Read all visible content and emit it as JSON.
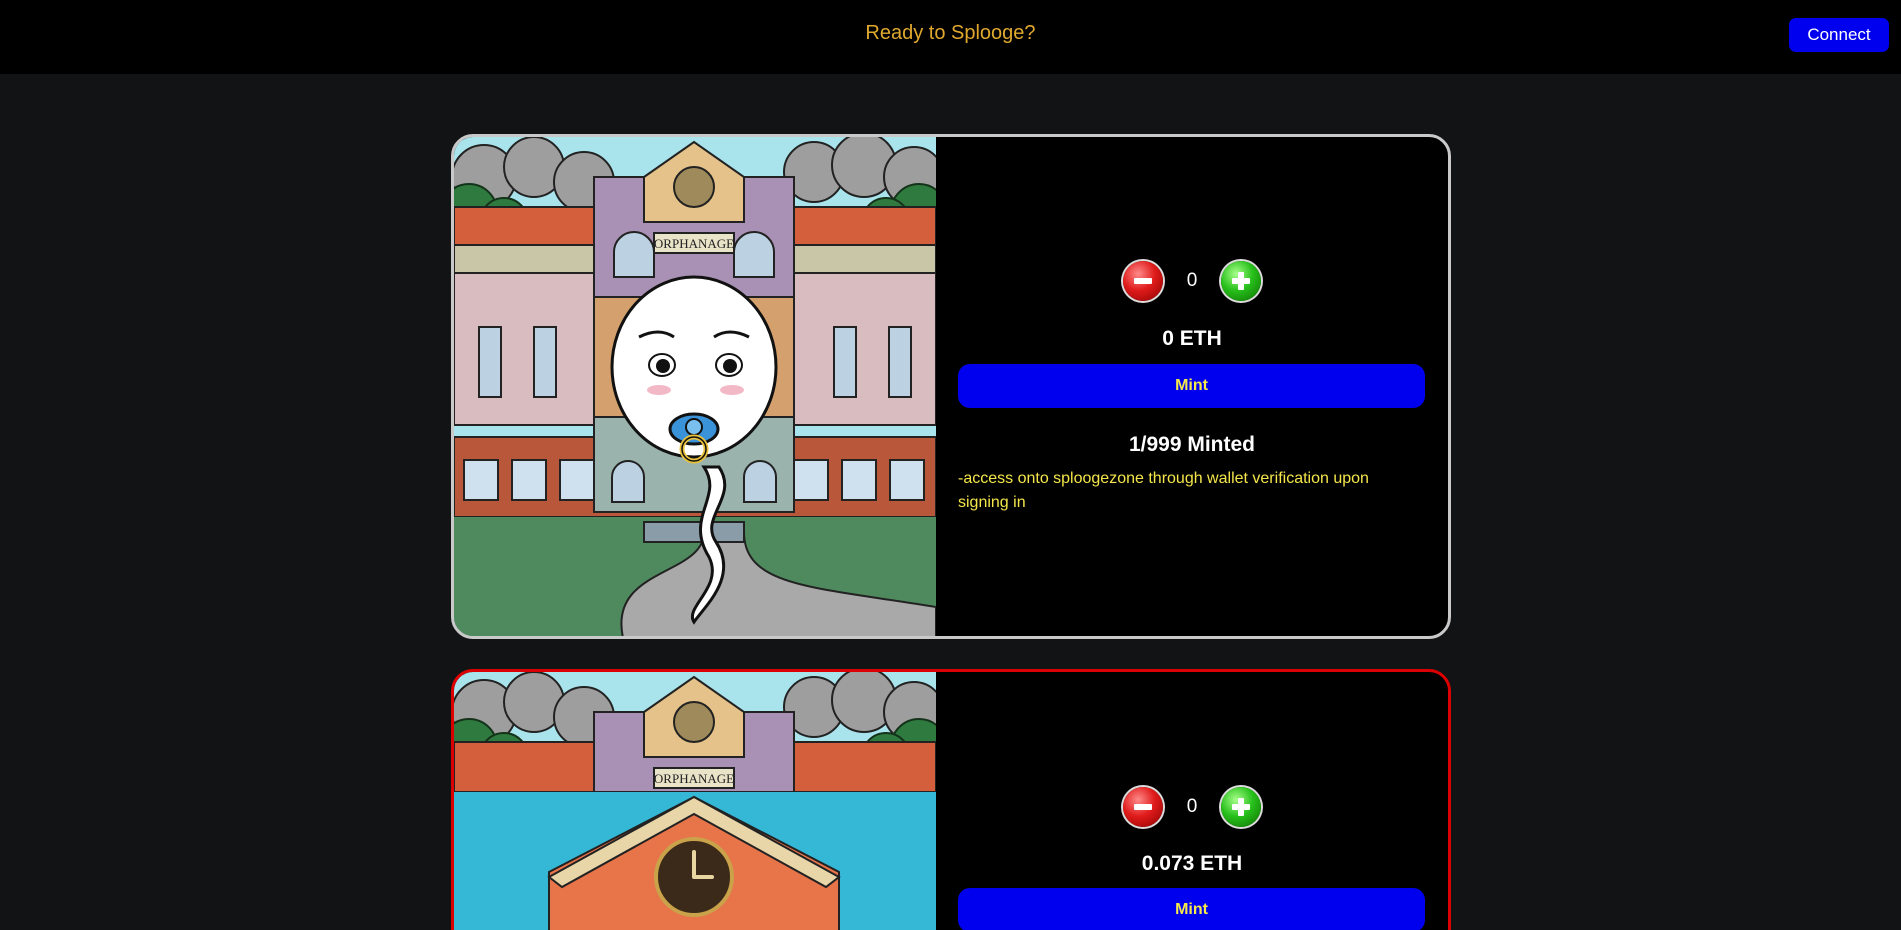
{
  "header": {
    "title": "Ready to Splooge?",
    "connect_label": "Connect"
  },
  "cards": [
    {
      "sign_text": "ORPHANAGE",
      "quantity": "0",
      "price": "0 ETH",
      "mint_label": "Mint",
      "minted": "1/999 Minted",
      "description": "-access onto sploogezone through wallet verification upon signing in",
      "border_color": "#c9c9c9"
    },
    {
      "sign_text": "ORPHANAGE",
      "quantity": "0",
      "price": "0.073 ETH",
      "mint_label": "Mint",
      "border_color": "#dd0000"
    }
  ],
  "colors": {
    "accent_blue": "#0000ee",
    "title_gold": "#e0a92e",
    "desc_yellow": "#f4e64a",
    "background": "#121315"
  },
  "icons": [
    "minus-circle-icon",
    "plus-circle-icon"
  ]
}
